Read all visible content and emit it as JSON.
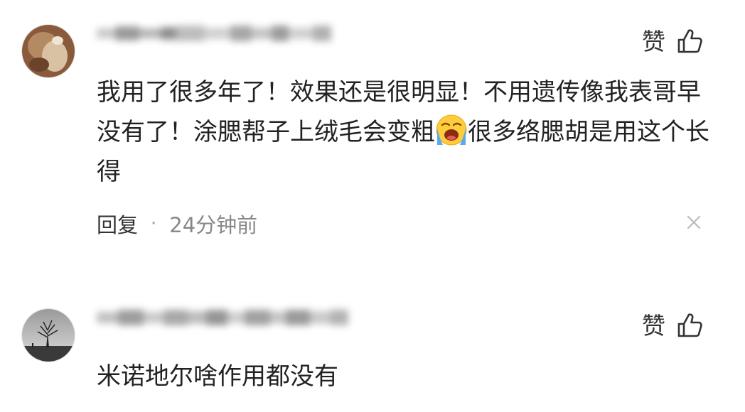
{
  "comments": [
    {
      "like_label": "赞",
      "text_part1": "我用了很多年了！效果还是很明显！不用遗传像我表哥早没有了！涂腮帮子上绒毛会变粗",
      "emoji": "loudly-crying-face-emoji",
      "text_part2": "很多络腮胡是用这个长得",
      "reply_label": "回复",
      "separator": "·",
      "time": "24分钟前"
    },
    {
      "like_label": "赞",
      "text": "米诺地尔啥作用都没有"
    }
  ],
  "icons": {
    "like": "thumbs-up-icon",
    "close": "close-icon"
  },
  "colors": {
    "text": "#222222",
    "muted": "#888888",
    "close_icon": "#bbbbbb"
  }
}
